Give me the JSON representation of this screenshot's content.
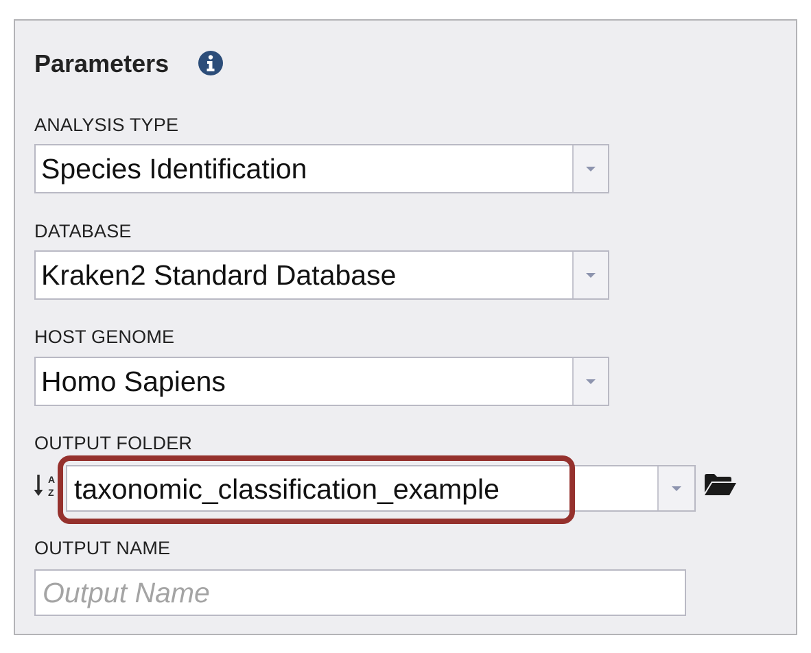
{
  "panel": {
    "title": "Parameters",
    "info_icon": "info-circle-icon"
  },
  "fields": {
    "analysis_type": {
      "label": "ANALYSIS TYPE",
      "value": "Species Identification"
    },
    "database": {
      "label": "DATABASE",
      "value": "Kraken2 Standard Database"
    },
    "host_genome": {
      "label": "HOST GENOME",
      "value": "Homo Sapiens"
    },
    "output_folder": {
      "label": "OUTPUT FOLDER",
      "value": "taxonomic_classification_example",
      "sort_icon": "sort-alpha-down-icon",
      "browse_icon": "folder-open-icon",
      "highlighted": true
    },
    "output_name": {
      "label": "OUTPUT NAME",
      "value": "",
      "placeholder": "Output Name"
    }
  },
  "colors": {
    "panel_background": "#eeeef1",
    "highlight_ring": "#95312d",
    "info_icon": "#2c4d79",
    "caret": "#8d94ae"
  }
}
